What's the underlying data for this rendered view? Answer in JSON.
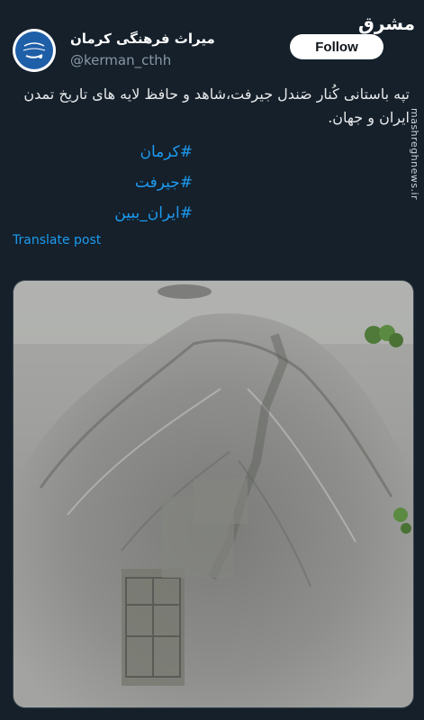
{
  "account": {
    "display_name": "میراث فرهنگی کرمان",
    "handle": "@kerman_cthh",
    "avatar_icon": "heritage-logo-icon"
  },
  "follow_button": {
    "label": "Follow"
  },
  "watermark": {
    "logo_text": "مشرق",
    "side_text": "mashreghnews.ir"
  },
  "tweet": {
    "text": "تپه باستانی کُنار صَندل جیرفت،شاهد و حافظ لایه های تاریخ تمدن ایران و جهان.",
    "hashtags": [
      "#کرمان",
      "#جیرفت",
      "#ایران_ببین"
    ],
    "translate_label": "Translate post"
  },
  "media": {
    "type": "photo",
    "subject": "aerial-archaeological-mound"
  },
  "colors": {
    "background": "#15202b",
    "link": "#1d9bf0",
    "secondary_text": "#8899a6"
  }
}
